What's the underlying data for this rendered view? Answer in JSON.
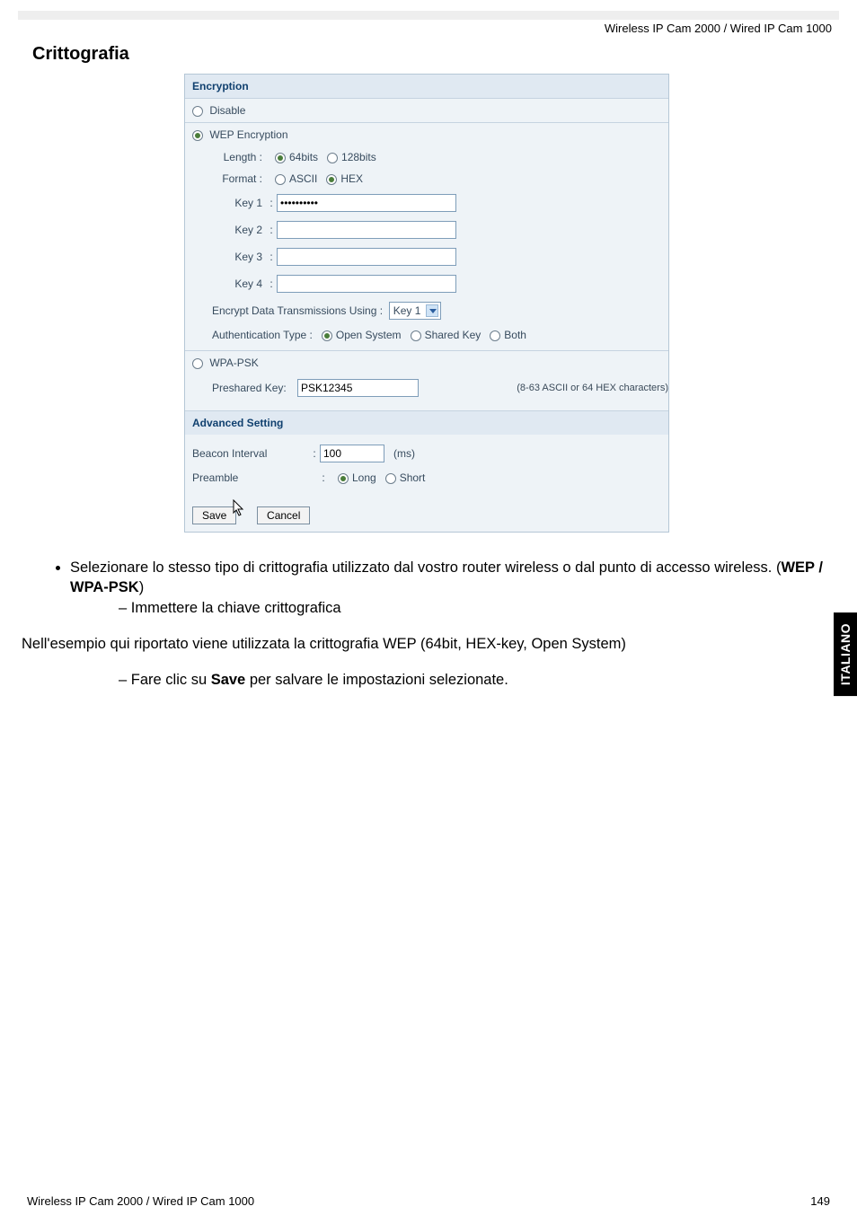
{
  "header": {
    "product": "Wireless IP Cam 2000 / Wired IP Cam 1000"
  },
  "section_title": "Crittografia",
  "encryption": {
    "header": "Encryption",
    "disable_label": "Disable",
    "wep_label": "WEP Encryption",
    "length_label": "Length :",
    "length_64": "64bits",
    "length_128": "128bits",
    "format_label": "Format :",
    "format_ascii": "ASCII",
    "format_hex": "HEX",
    "key1_label": "Key 1",
    "key2_label": "Key 2",
    "key3_label": "Key 3",
    "key4_label": "Key 4",
    "key1_value": "••••••••••",
    "encrypt_using_label": "Encrypt Data Transmissions Using :",
    "encrypt_using_value": "Key 1",
    "auth_type_label": "Authentication Type :",
    "auth_open": "Open System",
    "auth_shared": "Shared Key",
    "auth_both": "Both",
    "wpa_label": "WPA-PSK",
    "psk_label": "Preshared Key:",
    "psk_value": "PSK12345",
    "psk_hint": "(8-63 ASCII or 64 HEX characters)"
  },
  "advanced": {
    "header": "Advanced Setting",
    "beacon_label": "Beacon Interval",
    "beacon_value": "100",
    "beacon_unit": "(ms)",
    "preamble_label": "Preamble",
    "preamble_long": "Long",
    "preamble_short": "Short"
  },
  "buttons": {
    "save": "Save",
    "cancel": "Cancel"
  },
  "body_text": {
    "bullet1_a": "Selezionare lo stesso tipo di crittografia utilizzato dal vostro router wireless o dal punto di accesso wireless. (",
    "bullet1_b": "WEP / WPA-PSK",
    "bullet1_c": ")",
    "sub1": "Immettere la chiave crittografica",
    "para": "Nell'esempio qui riportato viene utilizzata la crittografia WEP (64bit, HEX-key, Open System)",
    "sub2_a": "Fare clic su ",
    "sub2_b": "Save",
    "sub2_c": " per salvare le impostazioni selezionate."
  },
  "side_tab": "ITALIANO",
  "footer": {
    "left": "Wireless IP Cam 2000 / Wired IP Cam 1000",
    "right": "149"
  }
}
